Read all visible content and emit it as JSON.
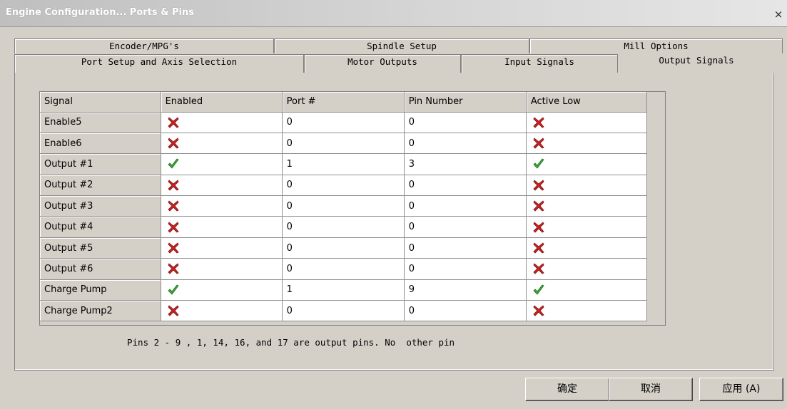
{
  "window": {
    "title": "Engine Configuration... Ports & Pins",
    "close": "×"
  },
  "tabs_top": [
    "Encoder/MPG's",
    "Spindle Setup",
    "Mill Options"
  ],
  "tabs_bottom": [
    "Port Setup and Axis Selection",
    "Motor Outputs",
    "Input Signals",
    "Output Signals"
  ],
  "active_tab": "Output Signals",
  "grid": {
    "columns": [
      "Signal",
      "Enabled",
      "Port #",
      "Pin Number",
      "Active Low"
    ],
    "rows": [
      {
        "signal": "Enable5",
        "enabled": false,
        "port": "0",
        "pin": "0",
        "active_low": false
      },
      {
        "signal": "Enable6",
        "enabled": false,
        "port": "0",
        "pin": "0",
        "active_low": false
      },
      {
        "signal": "Output #1",
        "enabled": true,
        "port": "1",
        "pin": "3",
        "active_low": true
      },
      {
        "signal": "Output #2",
        "enabled": false,
        "port": "0",
        "pin": "0",
        "active_low": false
      },
      {
        "signal": "Output #3",
        "enabled": false,
        "port": "0",
        "pin": "0",
        "active_low": false
      },
      {
        "signal": "Output #4",
        "enabled": false,
        "port": "0",
        "pin": "0",
        "active_low": false
      },
      {
        "signal": "Output #5",
        "enabled": false,
        "port": "0",
        "pin": "0",
        "active_low": false
      },
      {
        "signal": "Output #6",
        "enabled": false,
        "port": "0",
        "pin": "0",
        "active_low": false
      },
      {
        "signal": "Charge Pump",
        "enabled": true,
        "port": "1",
        "pin": "9",
        "active_low": true
      },
      {
        "signal": "Charge Pump2",
        "enabled": false,
        "port": "0",
        "pin": "0",
        "active_low": false
      }
    ]
  },
  "note": "Pins 2 - 9 , 1, 14, 16, and 17 are output pins. No  other pin",
  "buttons": {
    "ok": "确定",
    "cancel": "取消",
    "apply": "应用 (A)"
  },
  "colors": {
    "cross": "#cc2222",
    "check": "#3ca83c",
    "dialog_bg": "#d4d0c8"
  },
  "icons": {
    "enabled_true": "green-check-icon",
    "enabled_false": "red-cross-icon"
  }
}
